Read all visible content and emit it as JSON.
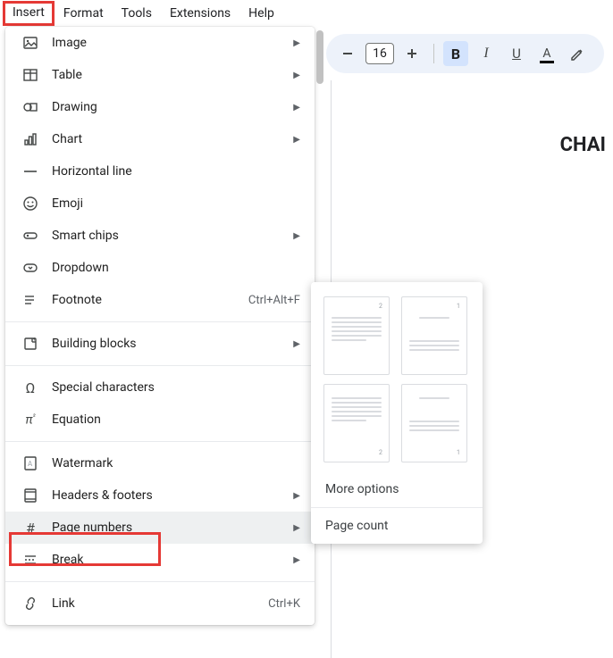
{
  "menubar": {
    "items": [
      "Insert",
      "Format",
      "Tools",
      "Extensions",
      "Help"
    ],
    "highlighted": "Insert"
  },
  "toolbar": {
    "font_size": "16"
  },
  "document": {
    "visible_title_fragment": "CHAI"
  },
  "insert_menu": {
    "items": [
      {
        "label": "Image",
        "icon": "image-icon",
        "submenu": true
      },
      {
        "label": "Table",
        "icon": "table-icon",
        "submenu": true
      },
      {
        "label": "Drawing",
        "icon": "drawing-icon",
        "submenu": true
      },
      {
        "label": "Chart",
        "icon": "chart-icon",
        "submenu": true
      },
      {
        "label": "Horizontal line",
        "icon": "horizontal-line-icon"
      },
      {
        "label": "Emoji",
        "icon": "emoji-icon"
      },
      {
        "label": "Smart chips",
        "icon": "smart-chips-icon",
        "submenu": true
      },
      {
        "label": "Dropdown",
        "icon": "dropdown-icon"
      },
      {
        "label": "Footnote",
        "icon": "footnote-icon",
        "shortcut": "Ctrl+Alt+F"
      }
    ],
    "group2": [
      {
        "label": "Building blocks",
        "icon": "building-blocks-icon",
        "submenu": true
      }
    ],
    "group3": [
      {
        "label": "Special characters",
        "icon": "special-characters-icon"
      },
      {
        "label": "Equation",
        "icon": "equation-icon"
      }
    ],
    "group4": [
      {
        "label": "Watermark",
        "icon": "watermark-icon"
      },
      {
        "label": "Headers & footers",
        "icon": "headers-footers-icon",
        "submenu": true
      },
      {
        "label": "Page numbers",
        "icon": "page-numbers-icon",
        "submenu": true,
        "hovered": true,
        "highlighted": true
      },
      {
        "label": "Break",
        "icon": "break-icon",
        "submenu": true
      }
    ],
    "group5": [
      {
        "label": "Link",
        "icon": "link-icon",
        "shortcut": "Ctrl+K"
      }
    ]
  },
  "page_numbers_submenu": {
    "more_options_label": "More options",
    "page_count_label": "Page count",
    "thumbs": [
      {
        "position": "header-right",
        "number": "2"
      },
      {
        "position": "header-right-skip-first",
        "number": "1"
      },
      {
        "position": "footer-right",
        "number": "2"
      },
      {
        "position": "footer-right-skip-first",
        "number": "1"
      }
    ]
  }
}
